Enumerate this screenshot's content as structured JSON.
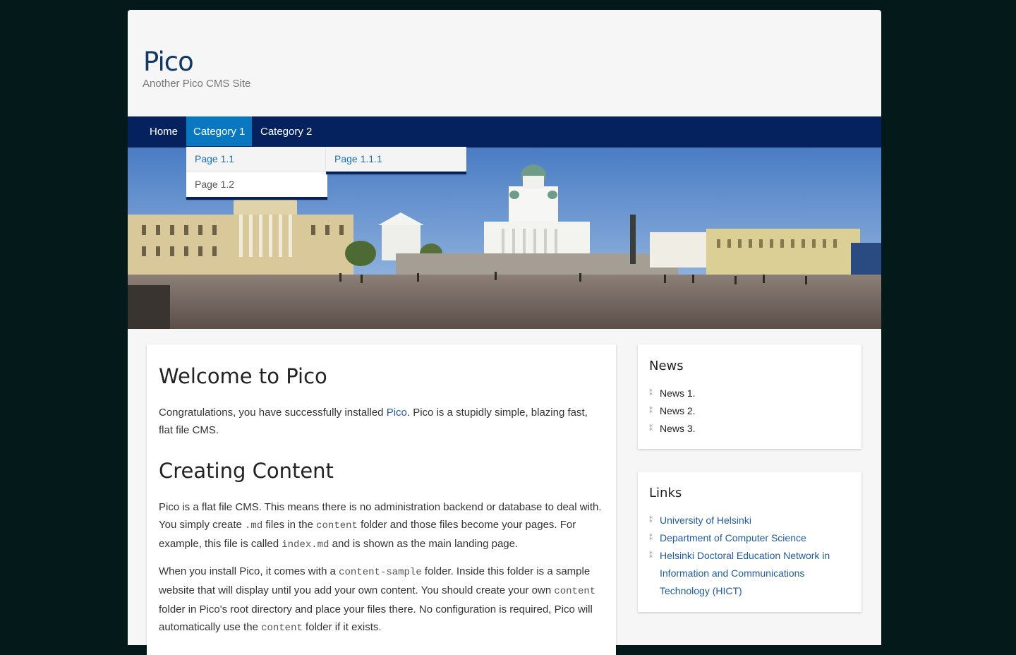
{
  "site": {
    "title": "Pico",
    "tagline": "Another Pico CMS Site"
  },
  "nav": {
    "home": "Home",
    "category1": "Category 1",
    "category2": "Category 2",
    "dropdown_cat1": [
      "Page 1.1",
      "Page 1.2"
    ],
    "dropdown_page11": [
      "Page 1.1.1"
    ]
  },
  "main": {
    "heading1": "Welcome to Pico",
    "intro_before": "Congratulations, you have successfully installed ",
    "intro_link": "Pico",
    "intro_after": ". Pico is a stupidly simple, blazing fast, flat file CMS.",
    "heading2": "Creating Content",
    "p2_a": "Pico is a flat file CMS. This means there is no administration backend or database to deal with. You simply create ",
    "p2_code1": ".md",
    "p2_b": " files in the ",
    "p2_code2": "content",
    "p2_c": " folder and those files become your pages. For example, this file is called ",
    "p2_code3": "index.md",
    "p2_d": " and is shown as the main landing page.",
    "p3_a": "When you install Pico, it comes with a ",
    "p3_code1": "content-sample",
    "p3_b": " folder. Inside this folder is a sample website that will display until you add your own content. You should create your own ",
    "p3_code2": "content",
    "p3_c": " folder in Pico's root directory and place your files there. No configuration is required, Pico will automatically use the ",
    "p3_code3": "content",
    "p3_d": " folder if it exists."
  },
  "news": {
    "title": "News",
    "items": [
      "News 1.",
      "News 2.",
      "News 3."
    ]
  },
  "links": {
    "title": "Links",
    "items": [
      "University of Helsinki",
      "Department of Computer Science",
      "Helsinki Doctoral Education Network in Information and Communications Technology (HICT)"
    ]
  },
  "colors": {
    "navbar": "#05225e",
    "nav_active": "#0a78c0",
    "link": "#1e5b9e",
    "title": "#103a66"
  }
}
